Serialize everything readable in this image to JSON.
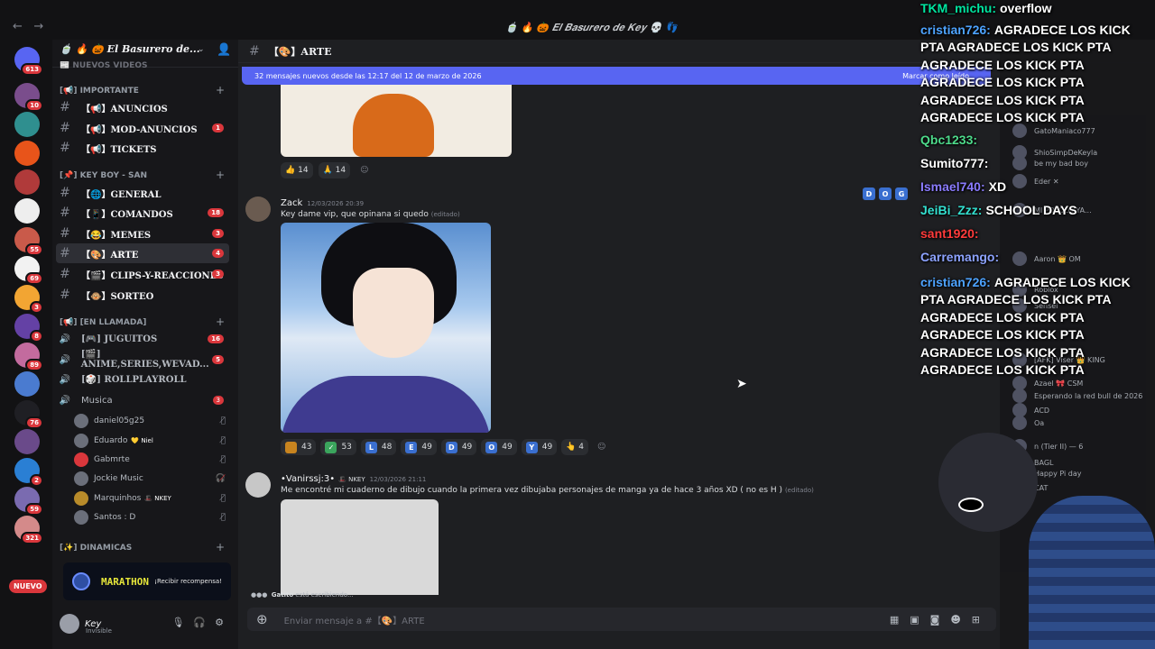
{
  "window": {
    "title": "🍵 🔥 🎃 𝑬𝒍 𝑩𝒂𝒔𝒖𝒓𝒆𝒓𝒐 𝒅𝒆 𝑲𝒆𝒚 💀 👣",
    "back": "←",
    "forward": "→"
  },
  "servers": {
    "home_badge": "613",
    "badges": [
      "10",
      "",
      "",
      "",
      "",
      "55",
      "69",
      "3",
      "8",
      "89",
      "",
      "76",
      "",
      "2",
      "59",
      "321"
    ],
    "nuevo": "NUEVO"
  },
  "guild": {
    "name": "🍵 🔥 🎃 𝑬𝒍 𝑩𝒂𝒔𝒖𝒓𝒆𝒓𝒐 𝒅𝒆..."
  },
  "categories": {
    "top": "📰 NUEVOS VIDEOS",
    "importante": "[📢] IMPORTANTE",
    "keyboy": "[📌] KEY BOY - SAN",
    "llamada": "[📢] [EN LLAMADA]",
    "dinamicas": "[✨] DINAMICAS"
  },
  "channels": [
    {
      "label": "【📢】ANUNCIOS",
      "count": ""
    },
    {
      "label": "【📢】MOD-ANUNCIOS",
      "count": "1"
    },
    {
      "label": "【📢】TICKETS",
      "count": ""
    },
    {
      "label": "【🌐】GENERAL",
      "count": ""
    },
    {
      "label": "【📱】COMANDOS",
      "count": "18"
    },
    {
      "label": "【😂】MEMES",
      "count": "3"
    },
    {
      "label": "【🎨】ARTE",
      "count": "4"
    },
    {
      "label": "【🎬】CLIPS-Y-REACCIONES",
      "count": "3"
    },
    {
      "label": "【🐵】SORTEO",
      "count": ""
    }
  ],
  "voice": [
    {
      "label": "[🎮] JUGUITOS",
      "count": "16"
    },
    {
      "label": "[🎬] ANIME,SERIES,WEVAD...",
      "count": "5"
    },
    {
      "label": "[🎲] ROLLPLAYROLL",
      "count": ""
    },
    {
      "label": "Musica",
      "count": "3"
    }
  ],
  "voice_users": [
    {
      "name": "daniel05g25",
      "tag": ""
    },
    {
      "name": "Eduardo",
      "tag": "💛 Niel"
    },
    {
      "name": "Gabmrte",
      "tag": ""
    },
    {
      "name": "Jockie Music",
      "tag": ""
    },
    {
      "name": "Marquinhos",
      "tag": "🎩 NKEY"
    },
    {
      "name": "Santos : D",
      "tag": ""
    }
  ],
  "banner": {
    "name": "MARATHON",
    "cta": "¡Recibir recompensa!"
  },
  "user": {
    "name": "Key",
    "status": "Invisible"
  },
  "channel_header": {
    "name": "【🎨】ARTE"
  },
  "new_messages": {
    "text": "32 mensajes nuevos desde las 12:17 del 12 de marzo de 2026",
    "mark": "Marcar como leído"
  },
  "reactions_top": [
    {
      "emoji": "👍",
      "count": "14"
    },
    {
      "emoji": "🙏",
      "count": "14"
    }
  ],
  "message1": {
    "author": "Zack",
    "time": "12/03/2026 20:39",
    "text": "Key dame vip, que opinana si quedo",
    "edited": "(editado)"
  },
  "reactions_mid": [
    {
      "letter": "",
      "count": "43"
    },
    {
      "letter": "✓",
      "count": "53"
    },
    {
      "letter": "L",
      "count": "48"
    },
    {
      "letter": "E",
      "count": "49"
    },
    {
      "letter": "D",
      "count": "49"
    },
    {
      "letter": "O",
      "count": "49"
    },
    {
      "letter": "Y",
      "count": "49"
    },
    {
      "letter": "👆",
      "count": "4"
    }
  ],
  "hover_letters": [
    "D",
    "O",
    "G"
  ],
  "message2": {
    "author": "•Vanirssj:3•",
    "clan": "🎩 NKEY",
    "time": "12/03/2026 21:11",
    "text": "Me encontré mi cuaderno de dibujo cuando la primera vez dibujaba personajes de manga ya de hace 3 años XD ( no es H )",
    "edited": "(editado)"
  },
  "typing": {
    "user": "Gatito",
    "text": " está escribiendo..."
  },
  "composer": {
    "placeholder": "Enviar mensaje a #【🎨】ARTE"
  },
  "members": [
    "GatoManiaco777",
    "ShioSimpDeKeyla",
    "be my bad boy",
    "Eder ✕",
    "MI POLOLO YA...",
    "Aaron 👑 OM",
    "Roblox",
    "Sensei",
    "[AFK] Viser 👑 KING",
    "Azael 🎀 CSM",
    "Esperando la red bull de 2026",
    "ACD",
    "Oa",
    "n (Tier II) — 6",
    "BAGL",
    "Happy Pi day",
    "CAT"
  ],
  "chat_overlay": [
    {
      "user": "TKM_michu:",
      "color": "#00e5a0",
      "text": "overflow"
    },
    {
      "user": "cristian726:",
      "color": "#4da3ff",
      "text": "AGRADECE LOS KICK PTA AGRADECE LOS KICK PTA AGRADECE LOS KICK PTA AGRADECE LOS KICK PTA AGRADECE LOS KICK PTA AGRADECE LOS KICK PTA"
    },
    {
      "user": "Qbc1233:",
      "color": "#4dd98a",
      "text": ""
    },
    {
      "user": "Sumito777:",
      "color": "#ffffff",
      "text": ""
    },
    {
      "user": "Ismael740:",
      "color": "#8a7bff",
      "text": "XD"
    },
    {
      "user": "JeiBi_Zzz:",
      "color": "#33e0d0",
      "text": "SCHOOL DAYS"
    },
    {
      "user": "sant1920:",
      "color": "#ff3b3b",
      "text": ""
    },
    {
      "user": "Carremango:",
      "color": "#8da3ff",
      "text": ""
    },
    {
      "user": "cristian726:",
      "color": "#4da3ff",
      "text": "AGRADECE LOS KICK PTA AGRADECE LOS KICK PTA AGRADECE LOS KICK PTA AGRADECE LOS KICK PTA AGRADECE LOS KICK PTA AGRADECE LOS KICK PTA"
    }
  ]
}
